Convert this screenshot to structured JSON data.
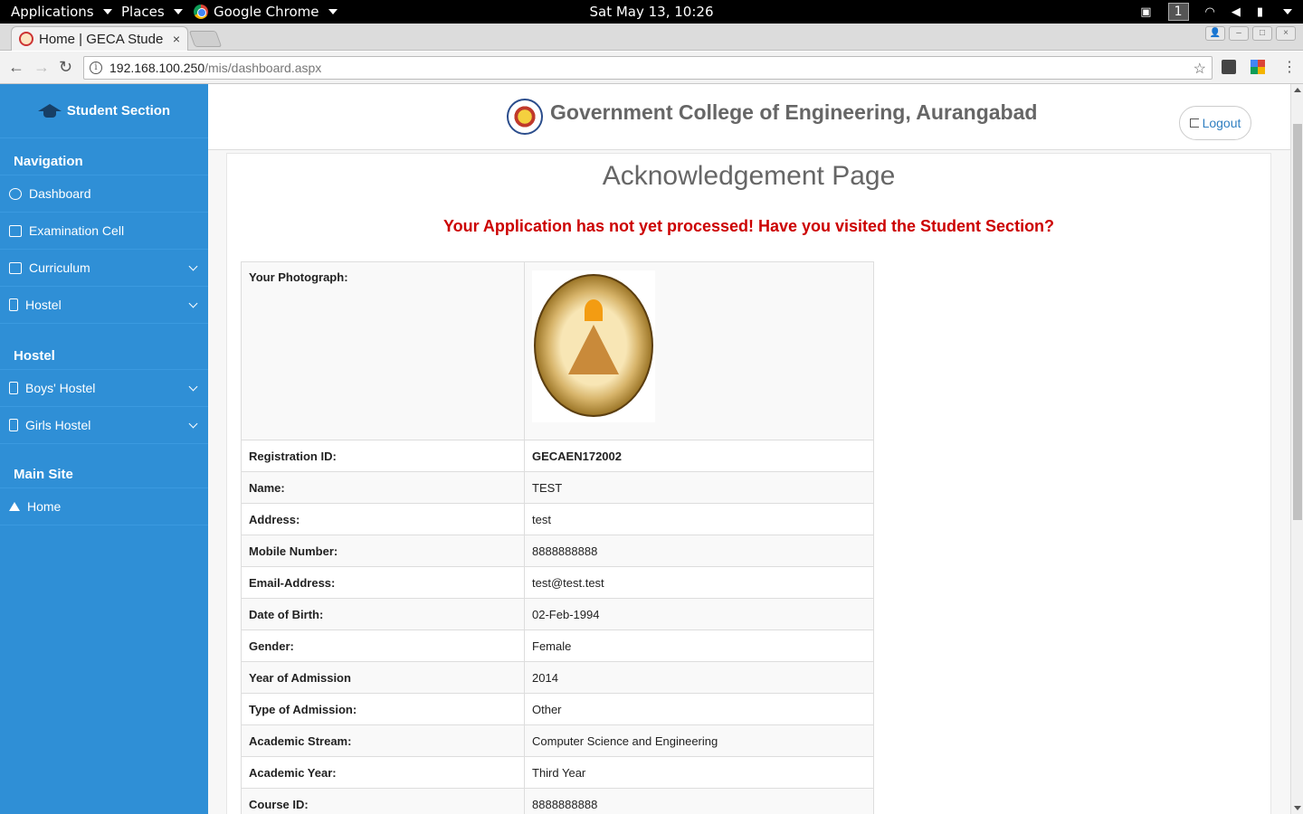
{
  "topbar": {
    "applications": "Applications",
    "places": "Places",
    "browser_app": "Google Chrome",
    "clock": "Sat May 13, 10:26",
    "workspace": "1"
  },
  "browser": {
    "tab_title": "Home | GECA Stude",
    "tab_close": "×",
    "url_host": "192.168.100.250",
    "url_path": "/mis/dashboard.aspx",
    "info_glyph": "i"
  },
  "sidebar": {
    "brand": "Student Section",
    "sections": [
      {
        "heading": "Navigation",
        "items": [
          "Dashboard",
          "Examination Cell",
          "Curriculum",
          "Hostel"
        ]
      },
      {
        "heading": "Hostel",
        "items": [
          "Boys' Hostel",
          "Girls Hostel"
        ]
      },
      {
        "heading": "Main Site",
        "items": [
          "Home"
        ]
      }
    ]
  },
  "header": {
    "college_name": "Government College of Engineering, Aurangabad",
    "logout": "Logout"
  },
  "page": {
    "title": "Acknowledgement Page",
    "warning": "Your Application has not yet processed! Have you visited the Student Section?",
    "photo_label": "Your Photograph:",
    "fields": [
      {
        "label": "Registration ID:",
        "value": "GECAEN172002"
      },
      {
        "label": "Name:",
        "value": "TEST"
      },
      {
        "label": "Address:",
        "value": "test"
      },
      {
        "label": "Mobile Number:",
        "value": "8888888888"
      },
      {
        "label": "Email-Address:",
        "value": "test@test.test"
      },
      {
        "label": "Date of Birth:",
        "value": "02-Feb-1994"
      },
      {
        "label": "Gender:",
        "value": "Female"
      },
      {
        "label": "Year of Admission",
        "value": "2014"
      },
      {
        "label": "Type of Admission:",
        "value": "Other"
      },
      {
        "label": "Academic Stream:",
        "value": "Computer Science and Engineering"
      },
      {
        "label": "Academic Year:",
        "value": "Third Year"
      },
      {
        "label": "Course ID:",
        "value": "8888888888"
      }
    ]
  },
  "colors": {
    "sidebar_bg": "#2f8fd6",
    "warning_red": "#cc0000",
    "link_blue": "#2f7fc1"
  }
}
